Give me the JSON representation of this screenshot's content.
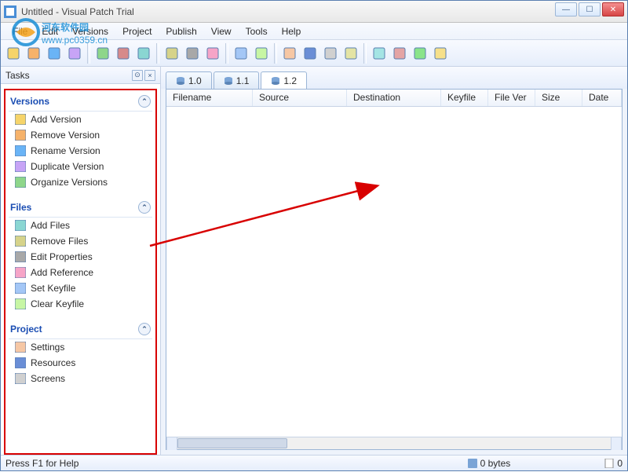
{
  "window": {
    "title": "Untitled - Visual Patch Trial"
  },
  "menu": {
    "items": [
      "File",
      "Edit",
      "Versions",
      "Project",
      "Publish",
      "View",
      "Tools",
      "Help"
    ]
  },
  "watermark": {
    "line1": "河东软件园",
    "line2": "www.pc0359.cn"
  },
  "sidebar": {
    "title": "Tasks",
    "groups": [
      {
        "title": "Versions",
        "items": [
          {
            "icon": "add-version-icon",
            "label": "Add Version"
          },
          {
            "icon": "remove-version-icon",
            "label": "Remove Version"
          },
          {
            "icon": "rename-version-icon",
            "label": "Rename Version"
          },
          {
            "icon": "duplicate-version-icon",
            "label": "Duplicate Version"
          },
          {
            "icon": "organize-versions-icon",
            "label": "Organize Versions"
          }
        ]
      },
      {
        "title": "Files",
        "items": [
          {
            "icon": "add-files-icon",
            "label": "Add Files"
          },
          {
            "icon": "remove-files-icon",
            "label": "Remove Files"
          },
          {
            "icon": "edit-properties-icon",
            "label": "Edit Properties"
          },
          {
            "icon": "add-reference-icon",
            "label": "Add Reference"
          },
          {
            "icon": "set-keyfile-icon",
            "label": "Set Keyfile"
          },
          {
            "icon": "clear-keyfile-icon",
            "label": "Clear Keyfile"
          }
        ]
      },
      {
        "title": "Project",
        "items": [
          {
            "icon": "settings-icon",
            "label": "Settings"
          },
          {
            "icon": "resources-icon",
            "label": "Resources"
          },
          {
            "icon": "screens-icon",
            "label": "Screens"
          }
        ]
      }
    ]
  },
  "tabs": {
    "items": [
      "1.0",
      "1.1",
      "1.2"
    ],
    "active": 2
  },
  "grid": {
    "columns": [
      "Filename",
      "Source",
      "Destination",
      "Keyfile",
      "File Ver",
      "Size",
      "Date"
    ],
    "widths": [
      110,
      120,
      120,
      60,
      60,
      60,
      50
    ]
  },
  "status": {
    "help": "Press F1 for Help",
    "bytes": "0 bytes",
    "count": "0"
  },
  "toolbar_icons": [
    "new-file-icon",
    "open-icon",
    "save-icon",
    "wizard-icon",
    "sep",
    "db-add-icon",
    "db-remove-icon",
    "db-dup-icon",
    "sep",
    "page-add-icon",
    "page-remove-icon",
    "page-edit-icon",
    "sep",
    "ref-add-icon",
    "ref-rem-icon",
    "sep",
    "user-settings-icon",
    "attach-icon",
    "window-icon",
    "list-icon",
    "sep",
    "globe-icon",
    "box-icon",
    "help-icon",
    "pdf-icon"
  ],
  "colors": {
    "accent": "#1a4db3",
    "highlight_border": "#d80000"
  }
}
